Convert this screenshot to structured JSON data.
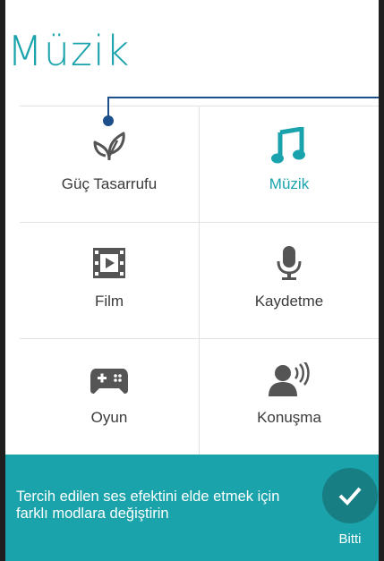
{
  "header": {
    "title": "Müzik"
  },
  "modes": [
    {
      "label": "Güç Tasarrufu",
      "icon": "leaf-icon"
    },
    {
      "label": "Müzik",
      "icon": "music-note-icon",
      "active": true
    },
    {
      "label": "Film",
      "icon": "film-icon"
    },
    {
      "label": "Kaydetme",
      "icon": "microphone-icon"
    },
    {
      "label": "Oyun",
      "icon": "gamepad-icon"
    },
    {
      "label": "Konuşma",
      "icon": "speaking-person-icon"
    }
  ],
  "tip": {
    "text": "Tercih edilen ses efektini elde etmek için farklı modlara değiştirin",
    "done_label": "Bitti"
  },
  "colors": {
    "accent": "#1aa3ad",
    "tip_bg": "#1ba3ab",
    "done_bg": "#177e84",
    "callout": "#1d4f8a"
  }
}
